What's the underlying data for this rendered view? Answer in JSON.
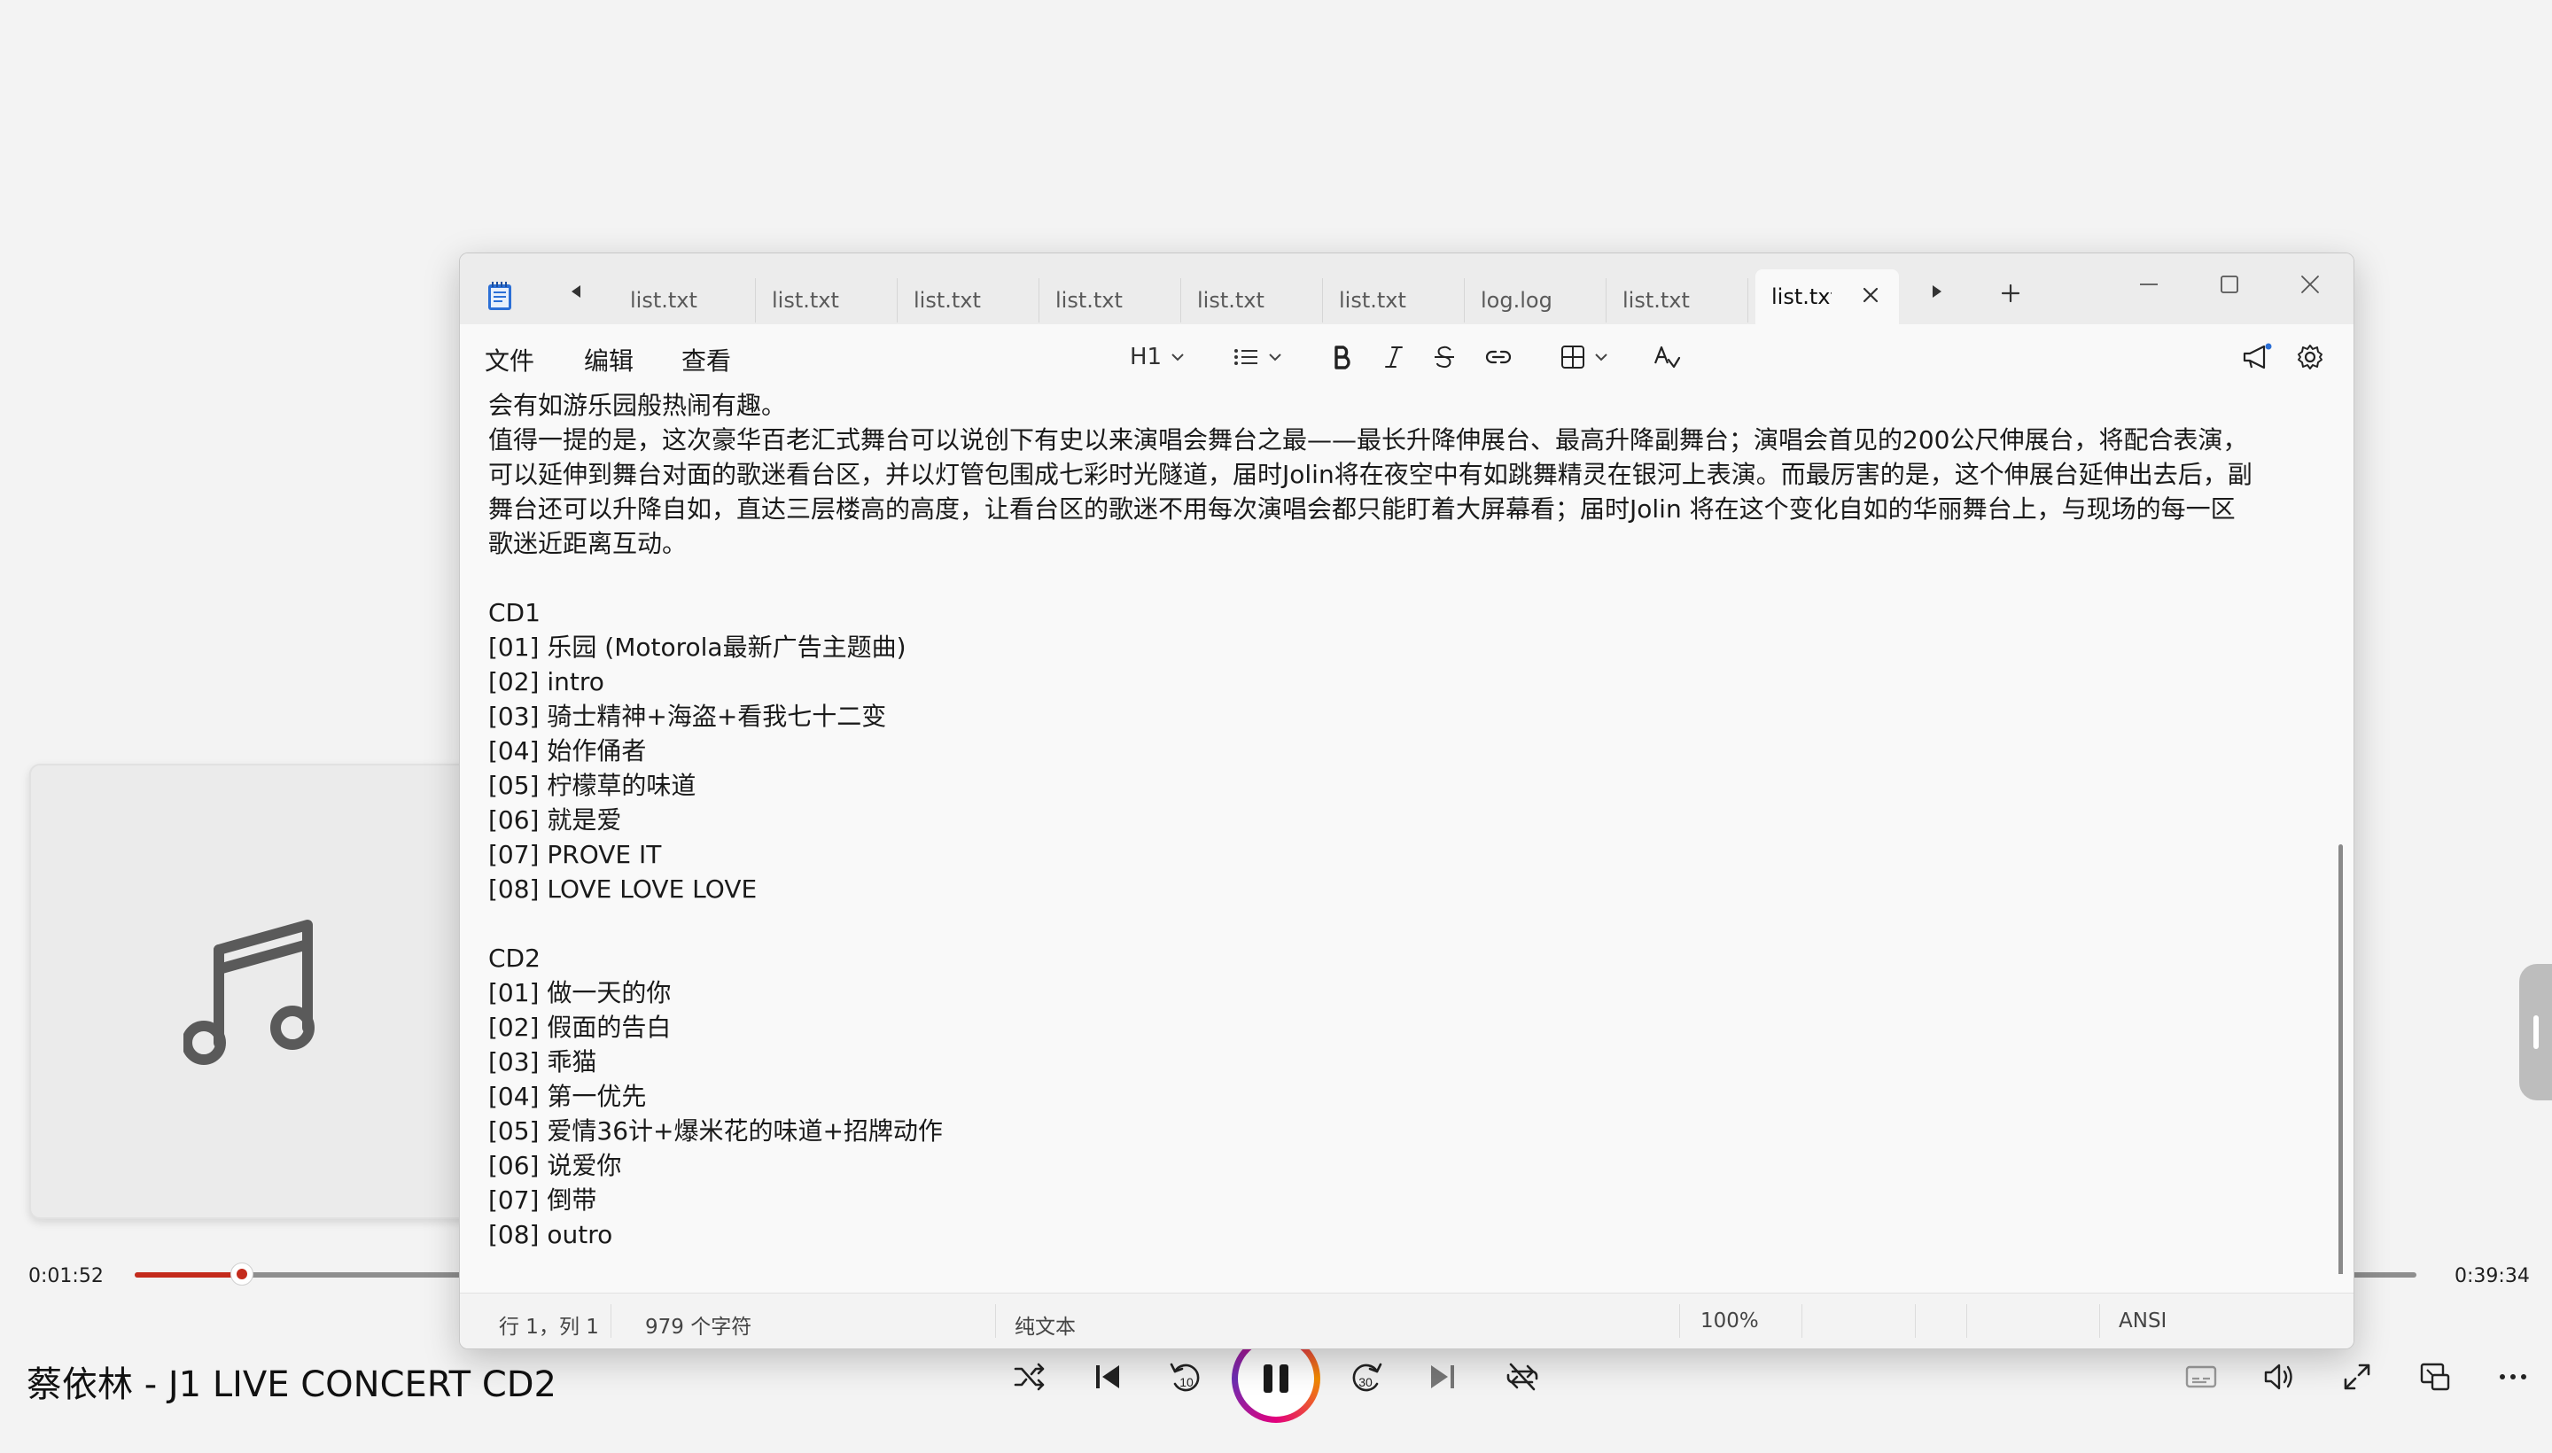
{
  "player": {
    "elapsed": "0:01:52",
    "duration": "0:39:34",
    "progress": 0.047,
    "title": "蔡依林 - J1 LIVE CONCERT CD2",
    "accent_color": "#c42b1c",
    "controls": [
      "shuffle-icon",
      "previous-icon",
      "rewind-10-icon",
      "pause-icon",
      "forward-30-icon",
      "next-icon",
      "repeat-icon"
    ],
    "rewind_label": "10",
    "forward_label": "30"
  },
  "notepad": {
    "tabs": [
      {
        "label": "list.txt"
      },
      {
        "label": "list.txt"
      },
      {
        "label": "list.txt"
      },
      {
        "label": "list.txt"
      },
      {
        "label": "list.txt"
      },
      {
        "label": "list.txt"
      },
      {
        "label": "log.log"
      },
      {
        "label": "list.txt"
      },
      {
        "label": "list.txt",
        "active": true
      }
    ],
    "menu": {
      "file": "文件",
      "edit": "编辑",
      "view": "查看"
    },
    "toolbar": {
      "heading": "H1"
    },
    "lines": [
      "会有如游乐园般热闹有趣。",
      "值得一提的是，这次豪华百老汇式舞台可以说创下有史以来演唱会舞台之最——最长升降伸展台、最高升降副舞台；演唱会首见的200公尺伸展台，将配合表演，",
      "可以延伸到舞台对面的歌迷看台区，并以灯管包围成七彩时光隧道，届时Jolin将在夜空中有如跳舞精灵在银河上表演。而最厉害的是，这个伸展台延伸出去后，副",
      "舞台还可以升降自如，直达三层楼高的高度，让看台区的歌迷不用每次演唱会都只能盯着大屏幕看；届时Jolin 将在这个变化自如的华丽舞台上，与现场的每一区",
      "歌迷近距离互动。",
      "",
      "CD1",
      "[01] 乐园 (Motorola最新广告主题曲)",
      "[02] intro",
      "[03] 骑士精神+海盗+看我七十二变",
      "[04] 始作俑者",
      "[05] 柠檬草的味道",
      "[06] 就是爱",
      "[07] PROVE IT",
      "[08] LOVE LOVE LOVE",
      "",
      "CD2",
      "[01] 做一天的你",
      "[02] 假面的告白",
      "[03] 乖猫",
      "[04] 第一优先",
      "[05] 爱情36计+爆米花的味道+招牌动作",
      "[06] 说爱你",
      "[07] 倒带",
      "[08] outro"
    ],
    "status": {
      "position": "行 1，列 1",
      "chars": "979 个字符",
      "format": "纯文本",
      "zoom": "100%",
      "line_ending": "",
      "encoding": "ANSI"
    }
  }
}
